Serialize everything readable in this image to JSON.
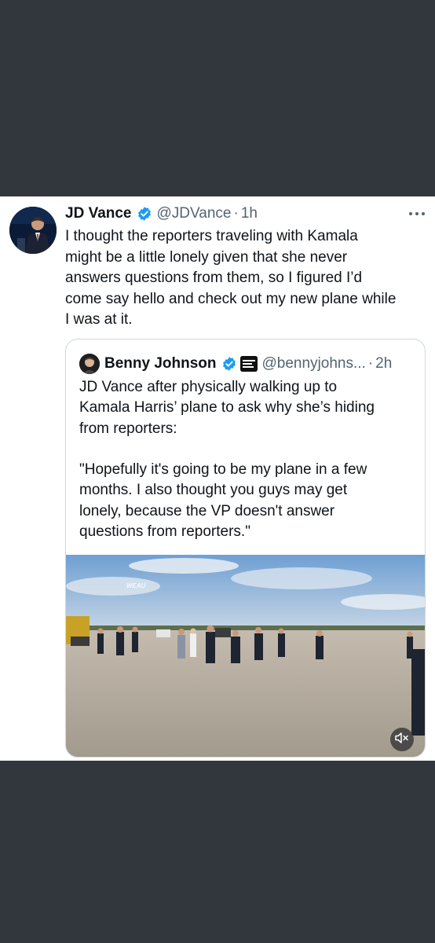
{
  "tweet": {
    "author_name": "JD Vance",
    "author_handle": "@JDVance",
    "separator": "·",
    "time": "1h",
    "text": "I thought the reporters traveling with Kamala\nmight be a little lonely given that she never\nanswers questions from them, so I figured I’d\ncome say hello and check out my new plane while\nI was at it.",
    "more_icon": "more-horizontal-icon",
    "verified_icon": "verified-badge-icon",
    "verified_color": "#1d9bf0"
  },
  "quote": {
    "author_name": "Benny Johnson",
    "author_handle": "@bennyjohns...",
    "separator": "·",
    "time": "2h",
    "text": "JD Vance after physically walking up to\nKamala Harris’ plane to ask why she’s hiding\nfrom reporters:\n\n\"Hopefully it's going to be my plane in a few\nmonths. I also thought you guys may get\nlonely, because the VP doesn't answer\nquestions from reporters.\"",
    "media": {
      "watermark": "WEAU",
      "mute_icon": "volume-muted-icon"
    }
  },
  "colors": {
    "background": "#31373d",
    "card": "#ffffff",
    "secondary_text": "#536471",
    "primary_text": "#0f1419"
  }
}
